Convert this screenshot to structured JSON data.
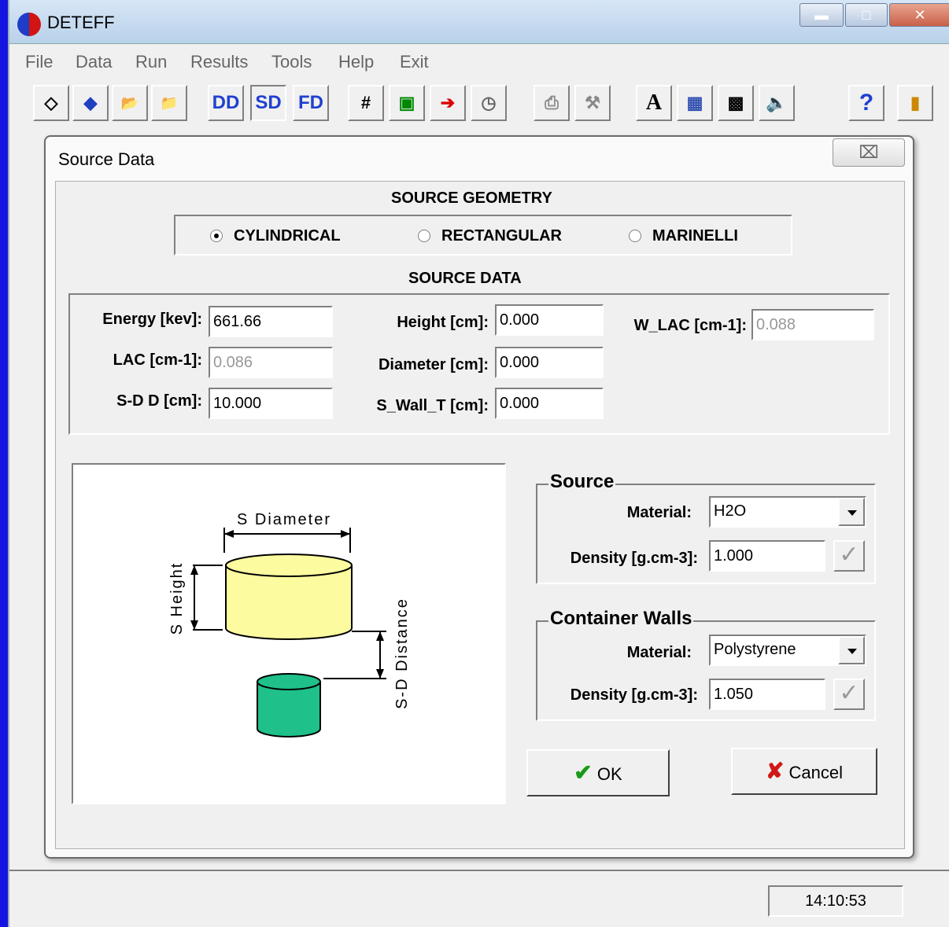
{
  "window": {
    "title": "DETEFF",
    "time": "14:10:53"
  },
  "menu": [
    "File",
    "Data",
    "Run",
    "Results",
    "Tools",
    "Help",
    "Exit"
  ],
  "toolbar": {
    "dd": "DD",
    "sd": "SD",
    "fd": "FD",
    "font": "A",
    "help": "?"
  },
  "dialog": {
    "title": "Source Data",
    "close": "⌧",
    "geometry_header": "SOURCE GEOMETRY",
    "geometry_options": [
      "CYLINDRICAL",
      "RECTANGULAR",
      "MARINELLI"
    ],
    "geometry_selected": "CYLINDRICAL",
    "data_header": "SOURCE DATA",
    "fields": {
      "energy_label": "Energy  [kev]:",
      "energy_value": "661.66",
      "lac_label": "LAC [cm-1]:",
      "lac_value": "0.086",
      "sdd_label": "S-D D  [cm]:",
      "sdd_value": "10.000",
      "height_label": "Height [cm]:",
      "height_value": "0.000",
      "diameter_label": "Diameter [cm]:",
      "diameter_value": "0.000",
      "swall_label": "S_Wall_T [cm]:",
      "swall_value": "0.000",
      "wlac_label": "W_LAC [cm-1]:",
      "wlac_value": "0.088"
    },
    "diagram": {
      "diameter": "S Diameter",
      "height": "S Height",
      "distance": "S-D Distance"
    },
    "source": {
      "title": "Source",
      "material_label": "Material:",
      "material_value": "H2O",
      "density_label": "Density [g.cm-3]:",
      "density_value": "1.000"
    },
    "walls": {
      "title": "Container Walls",
      "material_label": "Material:",
      "material_value": "Polystyrene",
      "density_label": "Density [g.cm-3]:",
      "density_value": "1.050"
    },
    "ok": "OK",
    "cancel": "Cancel"
  }
}
